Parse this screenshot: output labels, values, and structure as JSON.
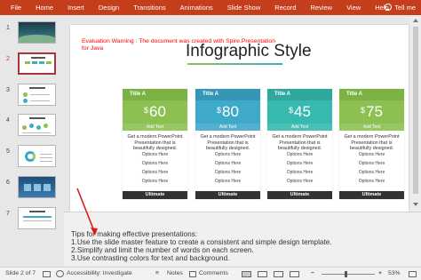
{
  "ribbon": {
    "tabs": [
      "File",
      "Home",
      "Insert",
      "Design",
      "Transitions",
      "Animations",
      "Slide Show",
      "Record",
      "Review",
      "View",
      "Help"
    ],
    "active_tab": "",
    "tell_me": "Tell me"
  },
  "thumbnails": [
    {
      "number": "1"
    },
    {
      "number": "2",
      "selected": true
    },
    {
      "number": "3"
    },
    {
      "number": "4"
    },
    {
      "number": "5"
    },
    {
      "number": "6"
    },
    {
      "number": "7"
    }
  ],
  "slide": {
    "warning": "Evaluation Warning : The document was created with  Spire.Presentation for Java",
    "title": "Infographic Style",
    "cards": [
      {
        "title": "Title A",
        "currency": "$",
        "price": "60",
        "sub": "Add Text",
        "desc": "Get a modern PowerPoint Presentation that is beautifully designed.",
        "options": [
          "Options Here",
          "Options Here",
          "Options Here",
          "Options Here"
        ],
        "button": "Ultimate",
        "color": "#8cc152",
        "head": "#7bb243"
      },
      {
        "title": "Title A",
        "currency": "$",
        "price": "80",
        "sub": "Add Text",
        "desc": "Get a modern PowerPoint Presentation that is beautifully designed.",
        "options": [
          "Options Here",
          "Options Here",
          "Options Here",
          "Options Here"
        ],
        "button": "Ultimate",
        "color": "#3fa9c9",
        "head": "#3597b5"
      },
      {
        "title": "Title A",
        "currency": "$",
        "price": "45",
        "sub": "Add Text",
        "desc": "Get a modern PowerPoint Presentation that is beautifully designed.",
        "options": [
          "Options Here",
          "Options Here",
          "Options Here",
          "Options Here"
        ],
        "button": "Ultimate",
        "color": "#36b9ae",
        "head": "#2fa79c"
      },
      {
        "title": "Title A",
        "currency": "$",
        "price": "75",
        "sub": "Add Text",
        "desc": "Get a modern PowerPoint Presentation that is beautifully designed.",
        "options": [
          "Options Here",
          "Options Here",
          "Options Here",
          "Options Here"
        ],
        "button": "Ultimate",
        "color": "#8cc152",
        "head": "#7bb243"
      }
    ]
  },
  "notes": {
    "lines": [
      "Tips for making effective presentations:",
      "1.Use the slide master feature to create a consistent and simple design template.",
      "2.Simplify and limit the number of words on each screen.",
      "3.Use contrasting colors for text and background."
    ]
  },
  "status": {
    "slide_info": "Slide 2 of 7",
    "accessibility": "Accessibility: Investigate",
    "notes": "Notes",
    "comments": "Comments",
    "zoom": "53%"
  },
  "colors": {
    "ribbon": "#c43e1c",
    "arrow": "#d81e1e"
  }
}
